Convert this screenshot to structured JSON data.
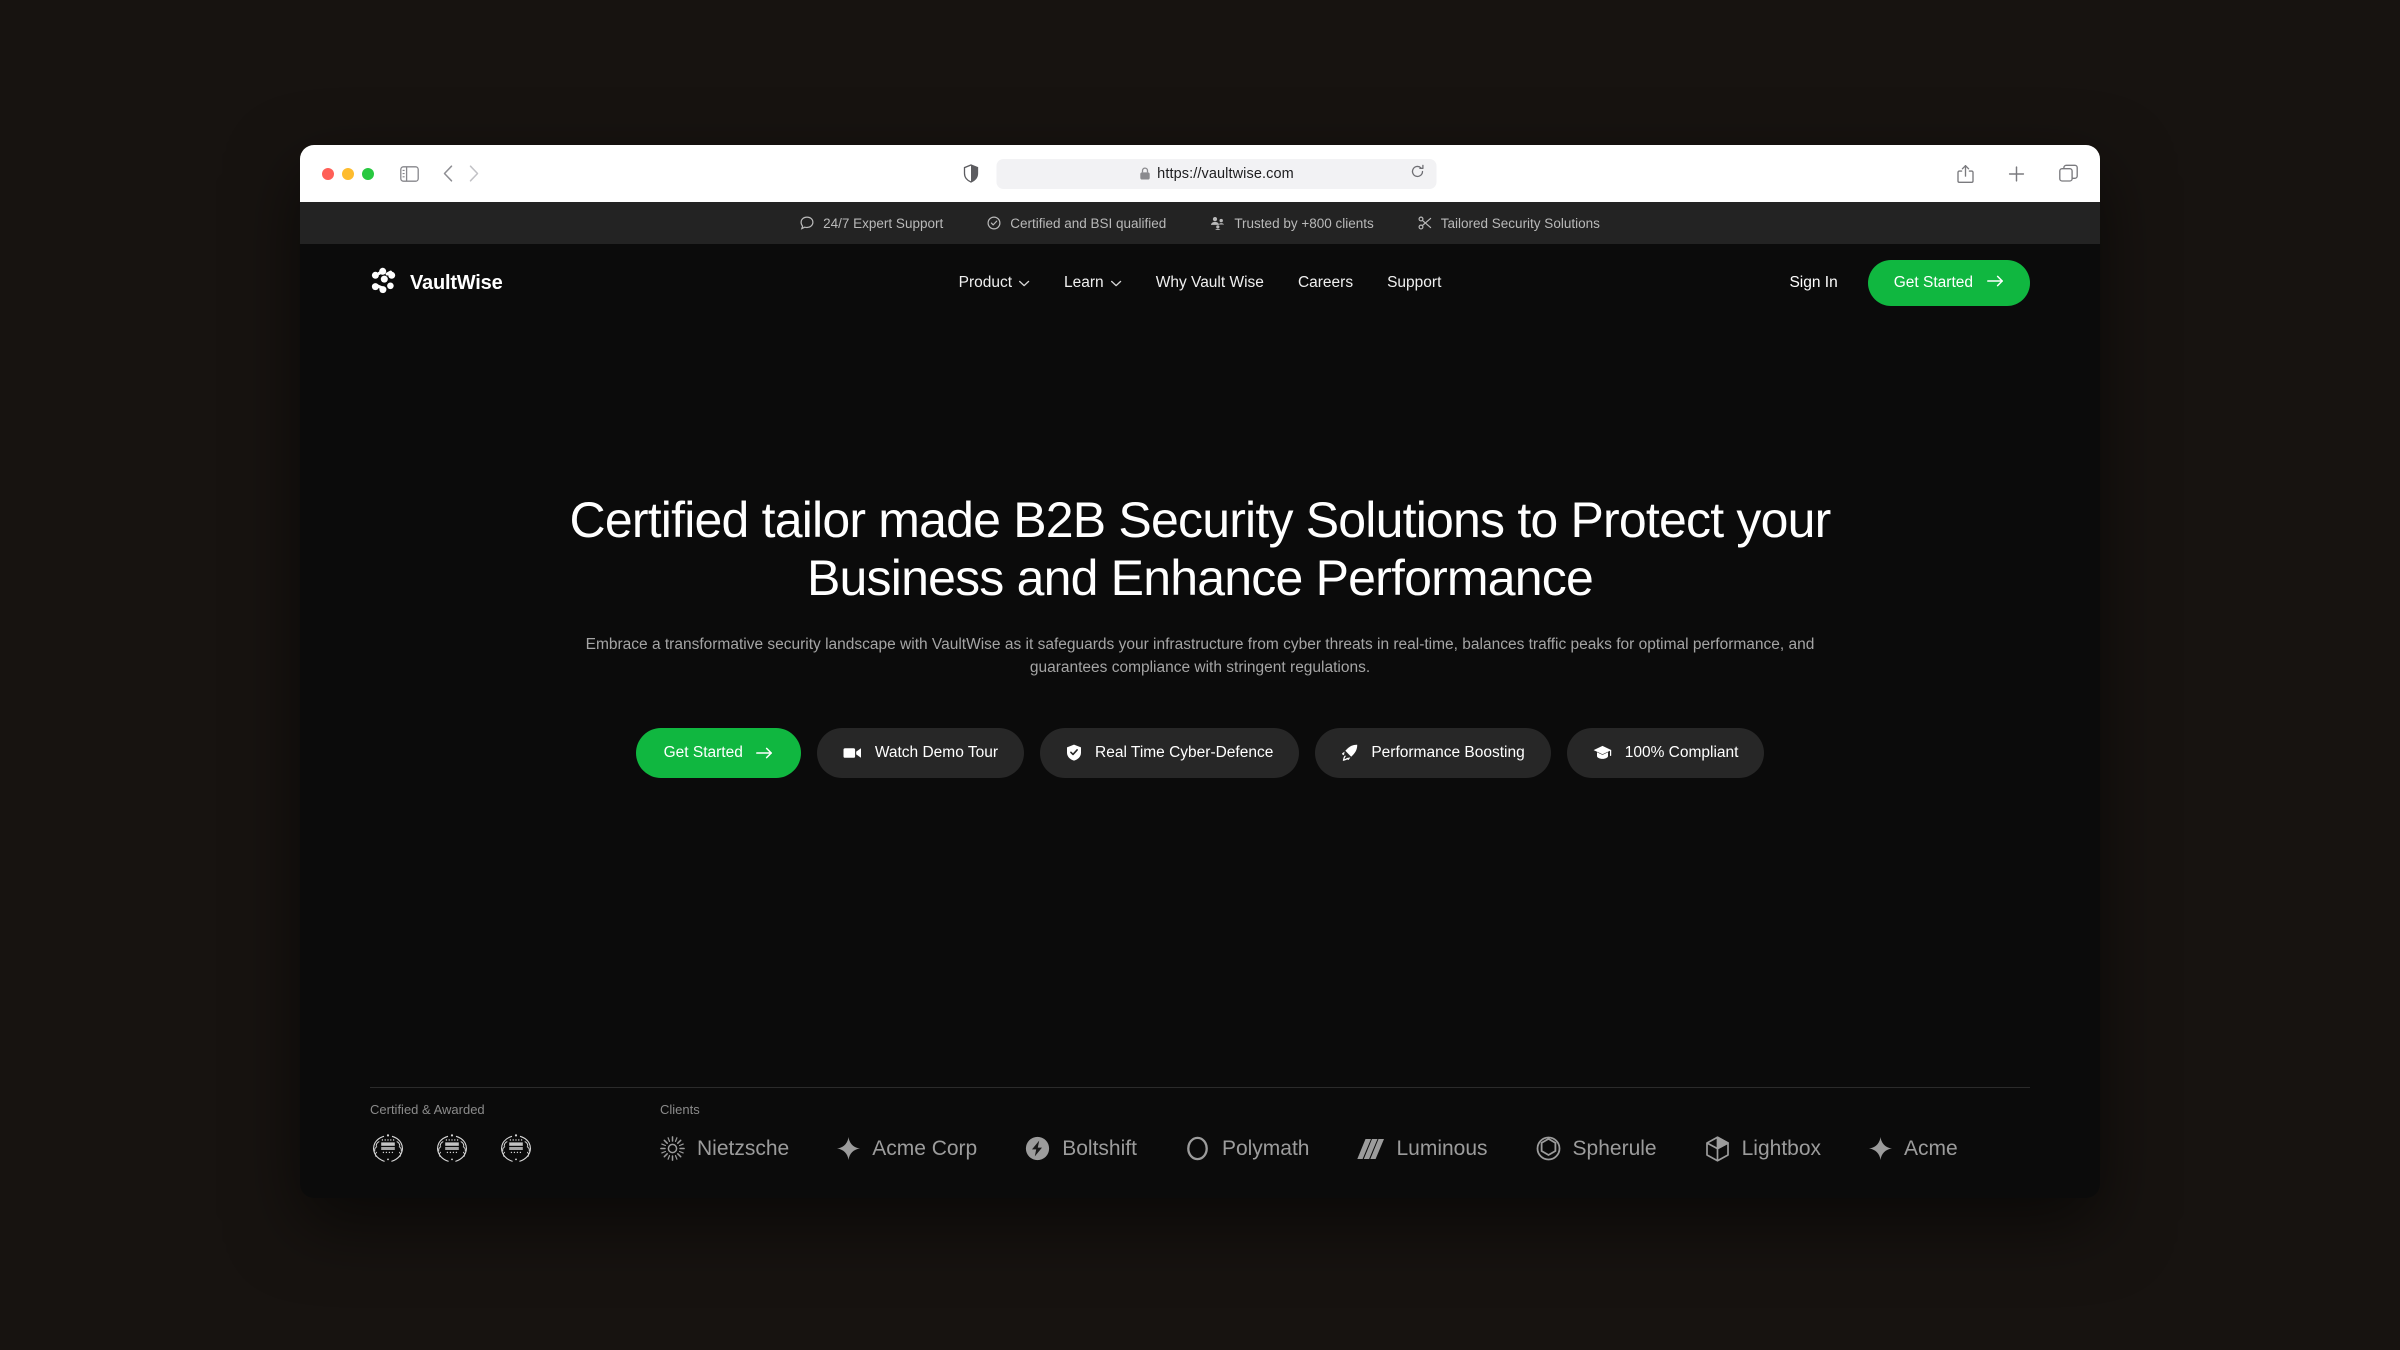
{
  "browser": {
    "url": "https://vaultwise.com",
    "icons": {
      "sidebar": "sidebar-toggle-icon",
      "back": "back-arrow-icon",
      "forward": "forward-arrow-icon",
      "shield": "shield-privacy-icon",
      "lock": "lock-icon",
      "reload": "reload-icon",
      "share": "share-icon",
      "new_tab": "plus-icon",
      "tabs": "tab-overview-icon"
    }
  },
  "announcement": {
    "items": [
      {
        "icon": "chat-bubble-icon",
        "label": "24/7 Expert Support"
      },
      {
        "icon": "check-circle-icon",
        "label": "Certified and BSI qualified"
      },
      {
        "icon": "users-icon",
        "label": "Trusted by +800 clients"
      },
      {
        "icon": "scissors-icon",
        "label": "Tailored Security Solutions"
      }
    ]
  },
  "header": {
    "brand": "VaultWise",
    "brand_icon": "vaultwise-nodes-logo",
    "nav": [
      {
        "label": "Product",
        "has_chevron": true
      },
      {
        "label": "Learn",
        "has_chevron": true
      },
      {
        "label": "Why Vault Wise",
        "has_chevron": false
      },
      {
        "label": "Careers",
        "has_chevron": false
      },
      {
        "label": "Support",
        "has_chevron": false
      }
    ],
    "sign_in": "Sign In",
    "get_started": "Get Started"
  },
  "hero": {
    "title": "Certified tailor made B2B Security Solutions to Protect your Business and Enhance Performance",
    "subtitle": "Embrace a transformative security landscape with VaultWise as it safeguards your infrastructure from cyber threats in real-time, balances traffic peaks for optimal performance, and guarantees compliance with stringent regulations.",
    "ctas": [
      {
        "label": "Get Started",
        "icon": "arrow-right-icon",
        "primary": true
      },
      {
        "label": "Watch Demo Tour",
        "icon": "video-camera-icon",
        "primary": false
      },
      {
        "label": "Real Time Cyber-Defence",
        "icon": "shield-check-icon",
        "primary": false
      },
      {
        "label": "Performance Boosting",
        "icon": "rocket-icon",
        "primary": false
      },
      {
        "label": "100% Compliant",
        "icon": "graduation-cap-icon",
        "primary": false
      }
    ]
  },
  "proof": {
    "awards_label": "Certified & Awarded",
    "clients_label": "Clients",
    "awards": [
      {
        "icon": "laurel-award-badge"
      },
      {
        "icon": "laurel-award-badge"
      },
      {
        "icon": "laurel-award-badge"
      }
    ],
    "clients": [
      {
        "name": "Nietzsche",
        "icon": "sunburst-icon"
      },
      {
        "name": "Acme Corp",
        "icon": "four-point-star-icon"
      },
      {
        "name": "Boltshift",
        "icon": "bolt-circle-icon"
      },
      {
        "name": "Polymath",
        "icon": "ring-icon"
      },
      {
        "name": "Luminous",
        "icon": "slanted-bars-icon"
      },
      {
        "name": "Spherule",
        "icon": "octagon-icon"
      },
      {
        "name": "Lightbox",
        "icon": "cube-icon"
      },
      {
        "name": "Acme",
        "icon": "four-point-star-icon"
      }
    ]
  },
  "colors": {
    "accent_green": "#10b740",
    "page_background": "#0b0b0b",
    "announce_background": "#232323",
    "desktop_background": "#171310"
  }
}
